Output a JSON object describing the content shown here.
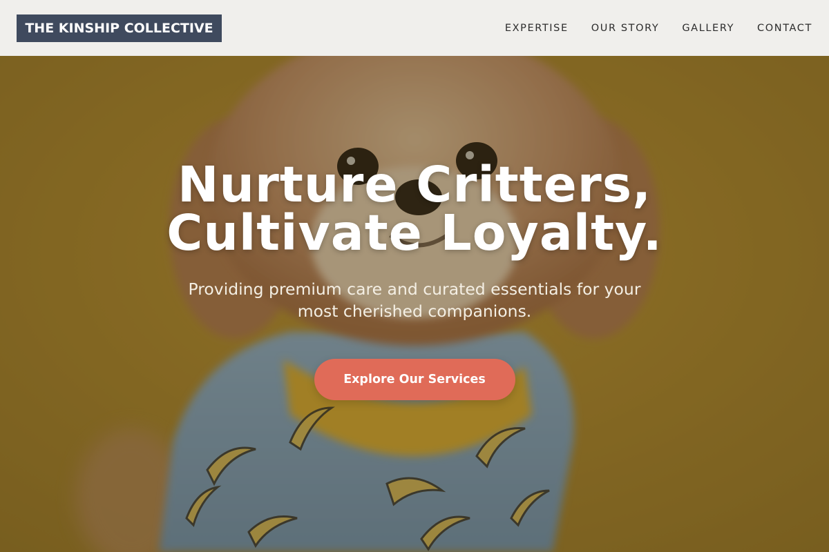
{
  "brand": {
    "name": "THE KINSHIP COLLECTIVE"
  },
  "nav": {
    "items": [
      {
        "label": "EXPERTISE"
      },
      {
        "label": "OUR STORY"
      },
      {
        "label": "GALLERY"
      },
      {
        "label": "CONTACT"
      }
    ]
  },
  "hero": {
    "headline_line1": "Nurture Critters,",
    "headline_line2": "Cultivate Loyalty.",
    "subheading": "Providing premium care and curated essentials for your most cherished companions.",
    "cta_label": "Explore Our Services",
    "image_subject": "small fluffy dog wearing a blue banana-print shirt with yellow collar on mustard background"
  },
  "colors": {
    "header_bg": "#f0efec",
    "logo_bg": "#3f4a5e",
    "hero_bg": "#b58e2e",
    "cta_bg": "#e06b58",
    "text_light": "#ffffff"
  }
}
